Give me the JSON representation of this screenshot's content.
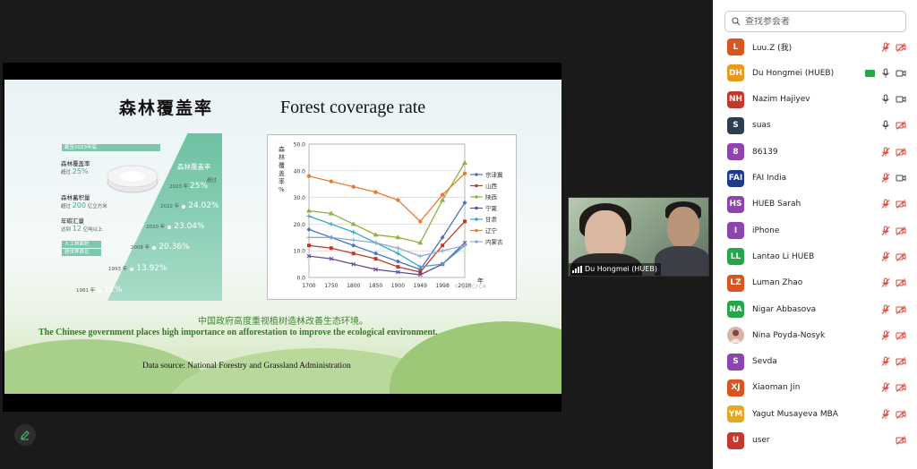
{
  "slide": {
    "title_cn": "森林覆盖率",
    "title_en": "Forest coverage rate",
    "info": {
      "header": "截至2023年底",
      "items": [
        {
          "label": "森林覆盖率",
          "prefix": "超过",
          "value": "25%",
          "suffix": ""
        },
        {
          "label": "森林蓄积量",
          "prefix": "超过",
          "value": "200",
          "suffix": "亿立方米"
        },
        {
          "label": "年碳汇量",
          "prefix": "达到",
          "value": "12",
          "suffix": "亿吨以上"
        },
        {
          "label": "人工林面积",
          "prefix": "",
          "value": "",
          "suffix": "居世界首位"
        }
      ],
      "cover_label": "森林覆盖率",
      "years": [
        {
          "year": "2023 年",
          "value": "25%",
          "note": "超过"
        },
        {
          "year": "2022 年",
          "value": "24.02%",
          "note": ""
        },
        {
          "year": "2020 年",
          "value": "23.04%",
          "note": ""
        },
        {
          "year": "2008 年",
          "value": "20.36%",
          "note": ""
        },
        {
          "year": "1993 年",
          "value": "13.92%",
          "note": ""
        },
        {
          "year": "1981 年",
          "value": "12%",
          "note": ""
        }
      ]
    },
    "chart_data": {
      "type": "line",
      "ylabel": "森林覆盖率%",
      "x_unit": "年",
      "watermark": "© 智慧CFCA",
      "x": [
        1700,
        1750,
        1800,
        1850,
        1900,
        1949,
        1998,
        2018
      ],
      "ylim": [
        0,
        50
      ],
      "yticks": [
        "0.0",
        "10.0",
        "20.0",
        "30.0",
        "40.0",
        "50.0"
      ],
      "series": [
        {
          "name": "京津冀",
          "color": "#4472c4",
          "marker": "diamond",
          "values": [
            18,
            15,
            12,
            9,
            6,
            3,
            15,
            28
          ]
        },
        {
          "name": "山西",
          "color": "#c0392b",
          "marker": "square",
          "values": [
            12,
            11,
            9,
            7,
            4,
            2,
            12,
            21
          ]
        },
        {
          "name": "陕西",
          "color": "#8db33a",
          "marker": "triangle",
          "values": [
            25,
            24,
            20,
            16,
            15,
            13,
            29,
            43
          ]
        },
        {
          "name": "宁夏",
          "color": "#6a4c9c",
          "marker": "x",
          "values": [
            8,
            7,
            5,
            3,
            2,
            1,
            5,
            13
          ]
        },
        {
          "name": "甘肃",
          "color": "#3aa7c2",
          "marker": "cross",
          "values": [
            23,
            20,
            17,
            13,
            9,
            4,
            5,
            12
          ]
        },
        {
          "name": "辽宁",
          "color": "#ec7c30",
          "marker": "circle",
          "values": [
            38,
            36,
            34,
            32,
            29,
            21,
            31,
            39
          ]
        },
        {
          "name": "内蒙古",
          "color": "#8fa9d6",
          "marker": "plus",
          "values": [
            15,
            15,
            14,
            13,
            11,
            8,
            10,
            12
          ]
        }
      ]
    },
    "caption_cn": "中国政府高度重视植树造林改善生态环境。",
    "caption_en": "The Chinese government places high importance on afforestation to improve the ecological environment.",
    "source": "Data source: National Forestry and Grassland Administration"
  },
  "video": {
    "name": "Du Hongmei (HUEB)"
  },
  "participants_panel": {
    "search_placeholder": "查找参会者",
    "list": [
      {
        "initials": "L",
        "name": "Luu.Z (我)",
        "color": "#d9541e",
        "mic": "muted",
        "cam": "off"
      },
      {
        "initials": "DH",
        "name": "Du Hongmei (HUEB)",
        "color": "#e89a1c",
        "mic": "on",
        "cam": "on",
        "share": true
      },
      {
        "initials": "NH",
        "name": "Nazim Hajiyev",
        "color": "#c0392b",
        "mic": "on",
        "cam": "on"
      },
      {
        "initials": "S",
        "name": "suas",
        "color": "#2d3e50",
        "mic": "on",
        "cam": "off"
      },
      {
        "initials": "8",
        "name": "86139",
        "color": "#8e44ad",
        "mic": "muted",
        "cam": "off"
      },
      {
        "initials": "FAI",
        "name": "FAI India",
        "color": "#1e3a8a",
        "mic": "muted",
        "cam": "on"
      },
      {
        "initials": "HS",
        "name": "HUEB Sarah",
        "color": "#8e44ad",
        "mic": "muted",
        "cam": "off"
      },
      {
        "initials": "I",
        "name": "iPhone",
        "color": "#8e44ad",
        "mic": "muted",
        "cam": "off"
      },
      {
        "initials": "LL",
        "name": "Lantao Li HUEB",
        "color": "#27a54a",
        "mic": "muted",
        "cam": "off"
      },
      {
        "initials": "LZ",
        "name": "Luman Zhao",
        "color": "#d9541e",
        "mic": "muted",
        "cam": "off"
      },
      {
        "initials": "NA",
        "name": "Nigar Abbasova",
        "color": "#27a54a",
        "mic": "muted",
        "cam": "off"
      },
      {
        "initials": "",
        "name": "Nina Poyda-Nosyk",
        "color": "#d8b4a8",
        "mic": "muted",
        "cam": "off"
      },
      {
        "initials": "S",
        "name": "Sevda",
        "color": "#8e44ad",
        "mic": "muted",
        "cam": "off"
      },
      {
        "initials": "XJ",
        "name": "Xiaoman Jin",
        "color": "#d9541e",
        "mic": "muted",
        "cam": "off"
      },
      {
        "initials": "YM",
        "name": "Yagut Musayeva MBA",
        "color": "#e8a81c",
        "mic": "muted",
        "cam": "off"
      },
      {
        "initials": "U",
        "name": "user",
        "color": "#c0392b",
        "mic": "none",
        "cam": "off"
      }
    ]
  }
}
